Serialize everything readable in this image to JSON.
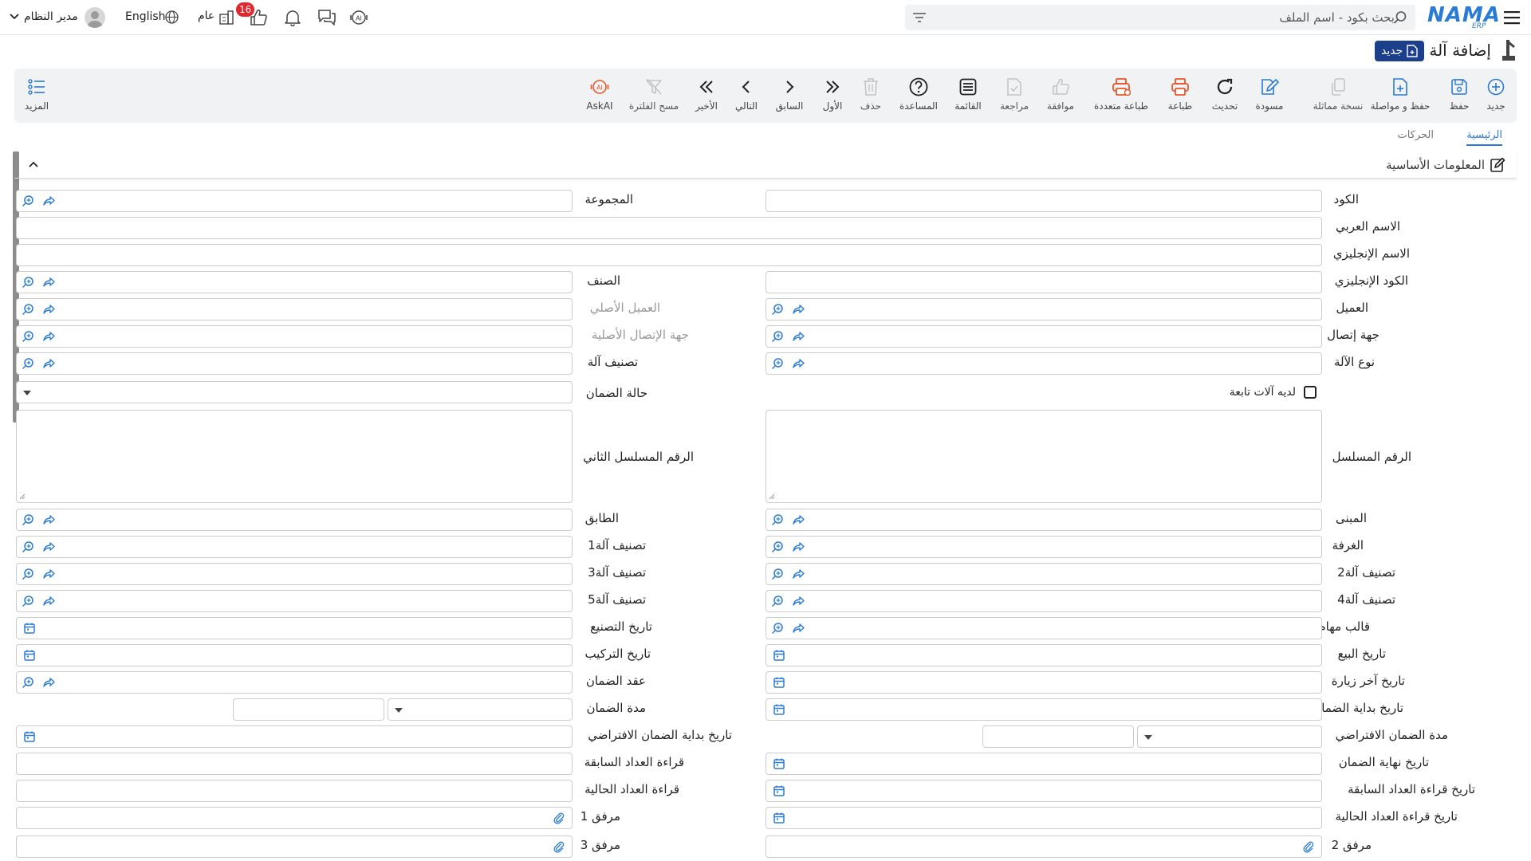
{
  "topbar": {
    "search_placeholder": "بحث بكود - اسم الملف",
    "logo_main": "NAMA",
    "logo_sub": "ERP",
    "language": "English",
    "branch": "عام",
    "notification_count": "16",
    "user_name": "مدير النظام"
  },
  "page": {
    "title": "إضافة آلة",
    "new_badge": "جديد"
  },
  "toolbar": {
    "new": "جديد",
    "save": "حفظ",
    "save_continue": "حفظ و مواصلة",
    "duplicate": "نسخة مماثلة",
    "draft": "مسودة",
    "refresh": "تحديث",
    "print": "طباعة",
    "multi_print": "طباعة متعددة",
    "approve": "موافقة",
    "review": "مراجعة",
    "list": "القائمة",
    "help": "المساعدة",
    "delete": "حذف",
    "first": "الأول",
    "previous": "السابق",
    "next": "التالي",
    "last": "الأخير",
    "clear_filter": "مسح الفلترة",
    "askai": "AskAI",
    "more": "المزيد"
  },
  "tabs": {
    "main": "الرئيسية",
    "movements": "الحركات"
  },
  "section": {
    "title": "المعلومات الأساسية"
  },
  "form": {
    "code": "الكود",
    "group": "المجموعة",
    "arabic_name": "الاسم العربي",
    "english_name": "الاسم الإنجليزي",
    "english_code": "الكود الإنجليزي",
    "item": "الصنف",
    "customer": "العميل",
    "original_customer": "العميل الأصلي",
    "contact": "جهة إتصال",
    "original_contact": "جهة الإتصال الأصلية",
    "machine_type": "نوع الآلة",
    "machine_category": "تصنيف آلة",
    "has_sub_machines": "لديه آلات تابعة",
    "warranty_status": "حالة الضمان",
    "serial_number": "الرقم المسلسل",
    "second_serial_number": "الرقم المسلسل الثاني",
    "building": "المبنى",
    "floor": "الطابق",
    "room": "الغرفة",
    "category1": "تصنيف آلة1",
    "category2": "تصنيف آلة2",
    "category3": "تصنيف آلة3",
    "category4": "تصنيف آلة4",
    "category5": "تصنيف آلة5",
    "task_template": "قالب مهام",
    "manufacture_date": "تاريخ التصنيع",
    "sale_date": "تاريخ البيع",
    "installation_date": "تاريخ التركيب",
    "last_visit_date": "تاريخ آخر زيارة",
    "warranty_contract": "عقد الضمان",
    "warranty_start_date": "تاريخ بداية الضمان",
    "warranty_period": "مدة الضمان",
    "default_warranty_period": "مدة الضمان الافتراضي",
    "default_warranty_start_date": "تاريخ بداية الضمان الافتراضي",
    "warranty_end_date": "تاريخ نهاية الضمان",
    "previous_counter_reading": "قراءة العداد السابقة",
    "previous_reading_date": "تاريخ قراءة العداد السابقة",
    "current_counter_reading": "قراءة العداد الحالية",
    "current_reading_date": "تاريخ قراءة العداد الحالية",
    "attachment1": "مرفق 1",
    "attachment2": "مرفق 2",
    "attachment3": "مرفق 3"
  },
  "colors": {
    "accent": "#2a7bd6",
    "badge_bg": "#1c3f8c",
    "danger": "#e0282e",
    "print_orange": "#e8552b"
  }
}
